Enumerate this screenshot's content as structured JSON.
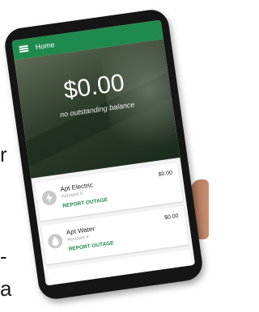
{
  "side_text": {
    "char_1": "r",
    "char_2": "-",
    "char_3": "a"
  },
  "appbar": {
    "title": "Home",
    "menu_icon": "hamburger-menu-icon"
  },
  "hero": {
    "amount": "$0.00",
    "message": "no outstanding balance"
  },
  "accounts": [
    {
      "name": "Apt Electric",
      "account_label": "Account #",
      "amount": "$0.00",
      "action": "REPORT OUTAGE",
      "icon": "lightning-icon"
    },
    {
      "name": "Apt Water",
      "account_label": "Account #",
      "amount": "$0.00",
      "action": "REPORT OUTAGE",
      "icon": "water-drop-icon"
    }
  ],
  "colors": {
    "brand_green": "#1f8a4d",
    "device_frame": "#151515"
  }
}
